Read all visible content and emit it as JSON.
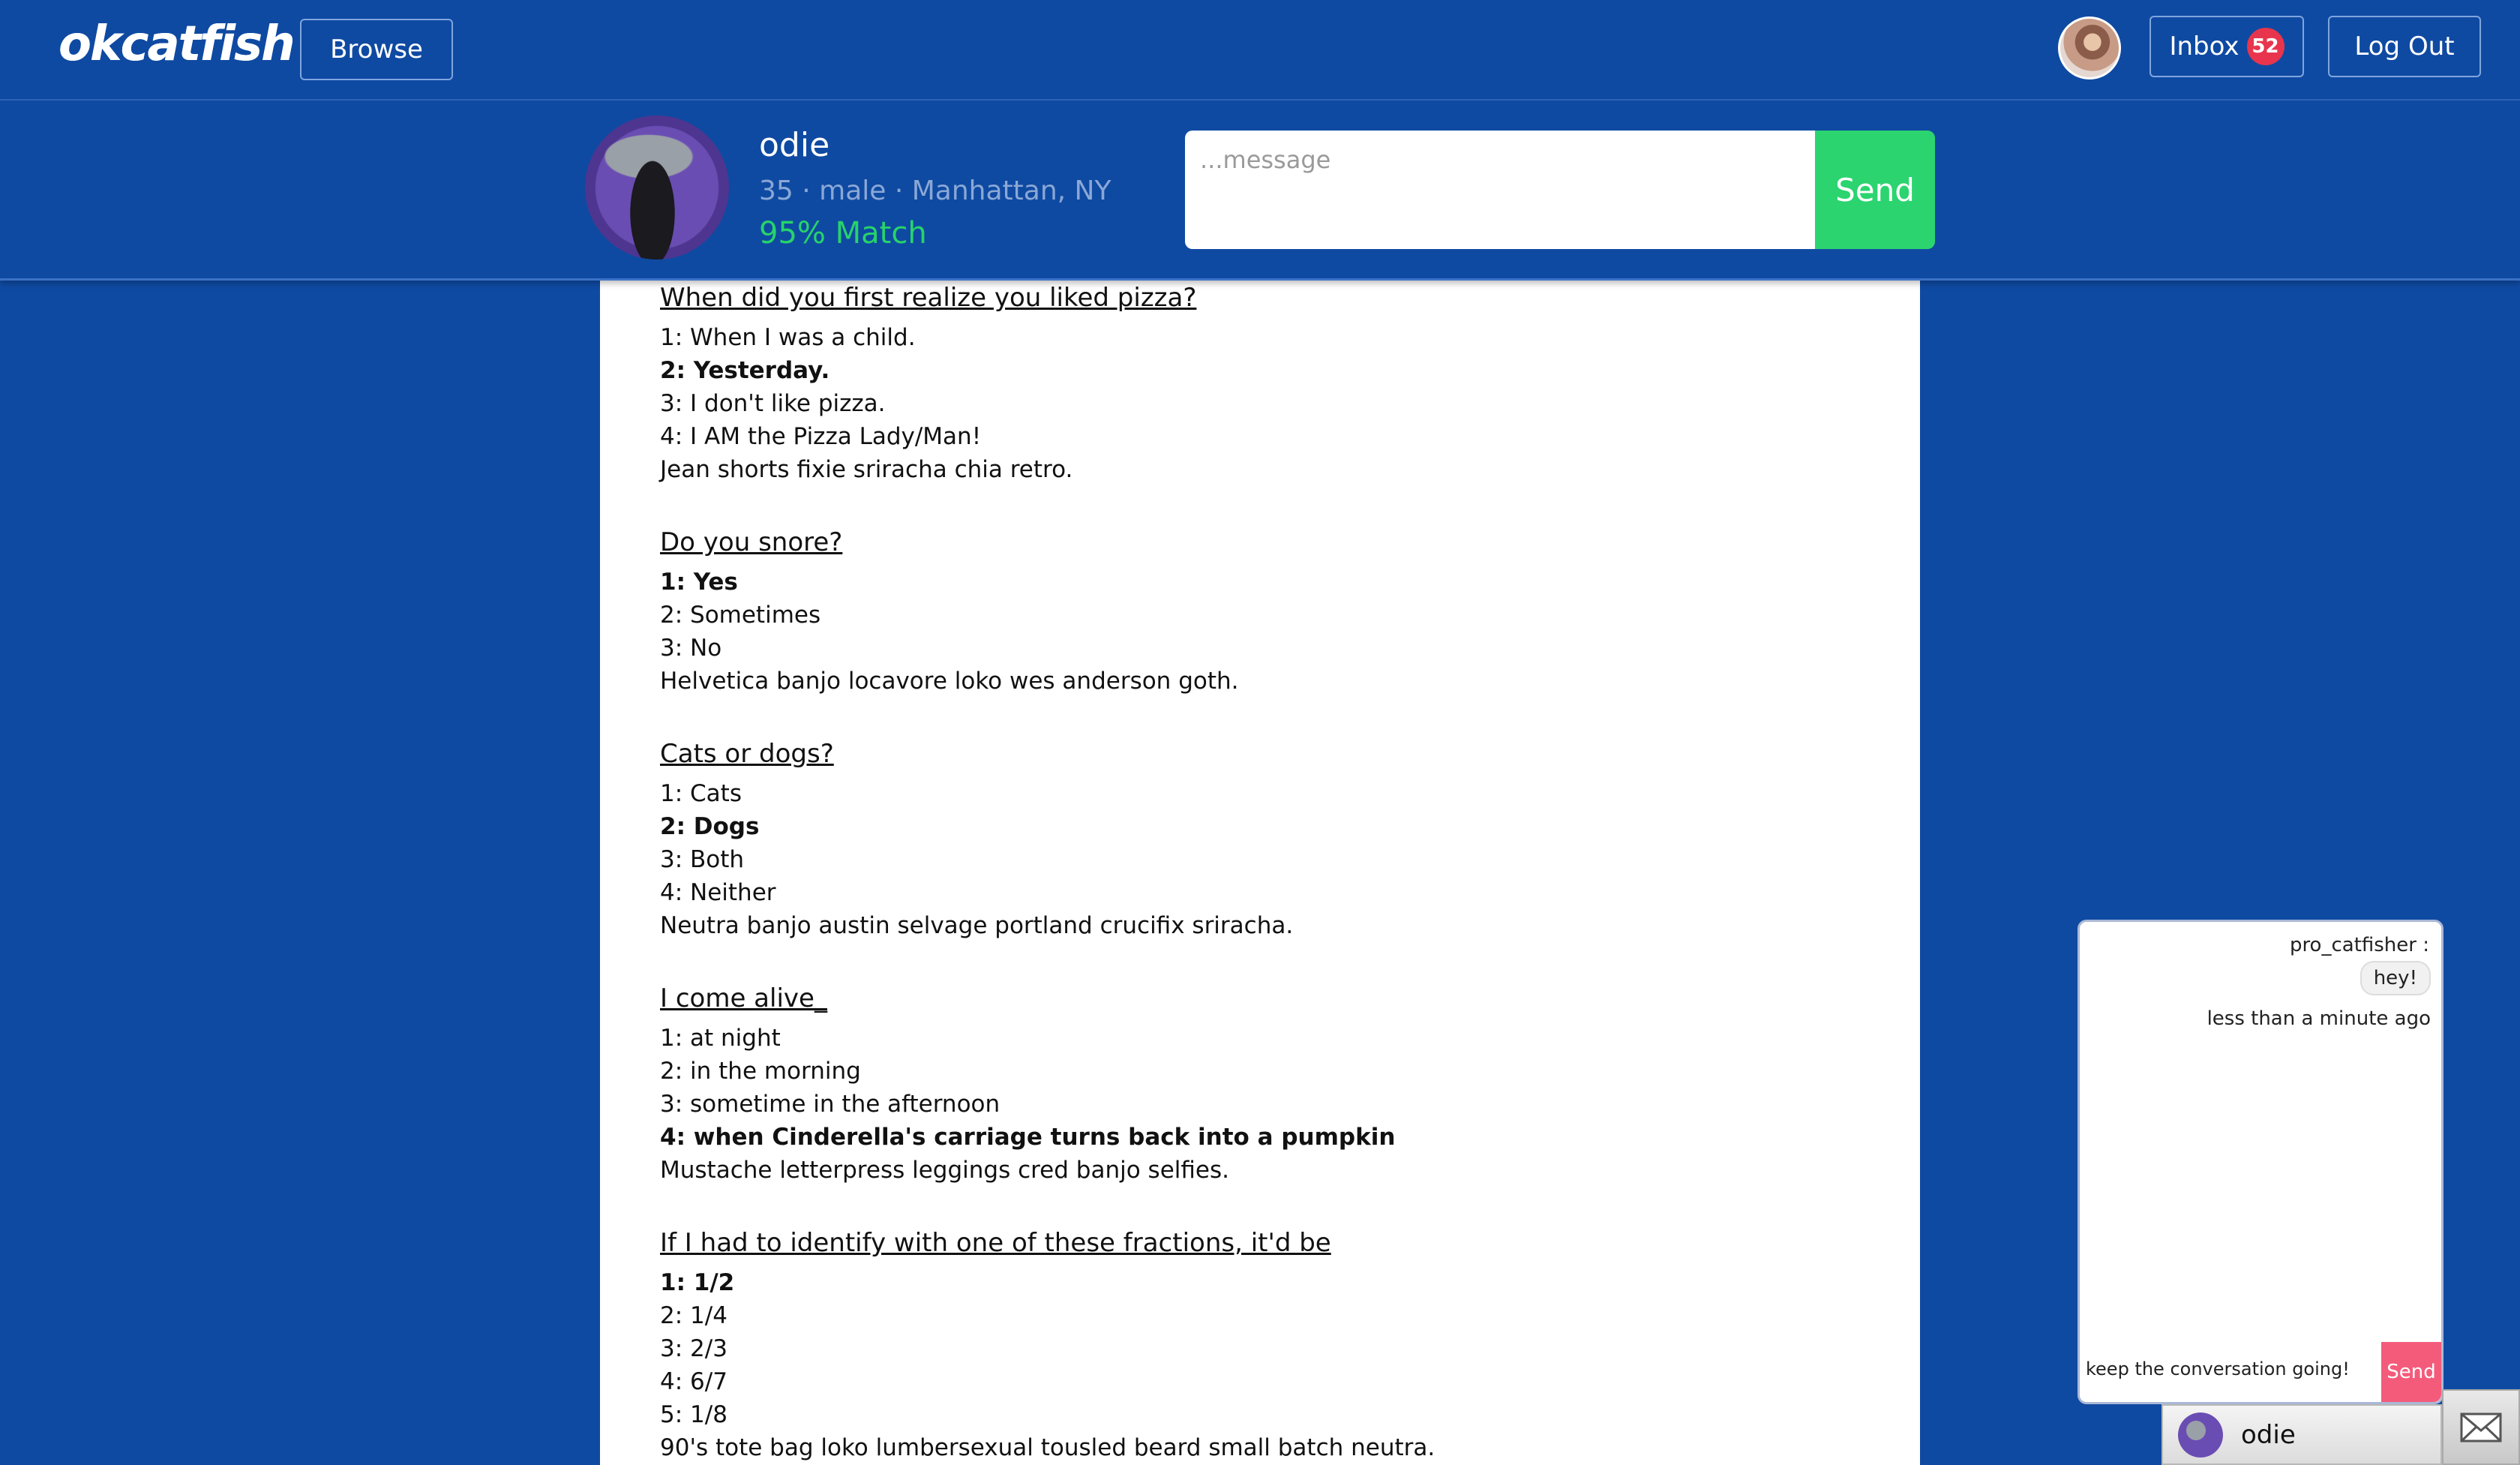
{
  "app": {
    "logo": "okcatfish"
  },
  "topnav": {
    "browse_label": "Browse",
    "inbox_label": "Inbox",
    "inbox_count": "52",
    "logout_label": "Log Out"
  },
  "profile": {
    "name": "odie",
    "subtitle": "35 · male · Manhattan, NY",
    "match": "95% Match",
    "message_placeholder": "...message",
    "send_label": "Send"
  },
  "questions": [
    {
      "title": "When did you first realize you liked pizza?",
      "answers": [
        "1: When I was a child.",
        "2: Yesterday.",
        "3: I don't like pizza.",
        "4: I AM the Pizza Lady/Man!"
      ],
      "selected": 1,
      "note": "Jean shorts fixie sriracha chia retro."
    },
    {
      "title": "Do you snore?",
      "answers": [
        "1: Yes",
        "2: Sometimes",
        "3: No"
      ],
      "selected": 0,
      "note": "Helvetica banjo locavore loko wes anderson goth."
    },
    {
      "title": "Cats or dogs?",
      "answers": [
        "1: Cats",
        "2: Dogs",
        "3: Both",
        "4: Neither"
      ],
      "selected": 1,
      "note": "Neutra banjo austin selvage portland crucifix sriracha."
    },
    {
      "title": "I come alive_",
      "answers": [
        "1: at night",
        "2: in the morning",
        "3: sometime in the afternoon",
        "4: when Cinderella's carriage turns back into a pumpkin"
      ],
      "selected": 3,
      "note": "Mustache letterpress leggings cred banjo selfies."
    },
    {
      "title": "If I had to identify with one of these fractions, it'd be",
      "answers": [
        "1: 1/2",
        "2: 1/4",
        "3: 2/3",
        "4: 6/7",
        "5: 1/8"
      ],
      "selected": 0,
      "note": "90's tote bag loko lumbersexual tousled beard small batch neutra."
    }
  ],
  "chat": {
    "sender": "pro_catfisher :",
    "message": "hey!",
    "time": "less than a minute ago",
    "input_value": "keep the conversation going!",
    "send_label": "Send",
    "tab_name": "odie"
  },
  "icons": {
    "mail": "mail-icon"
  }
}
